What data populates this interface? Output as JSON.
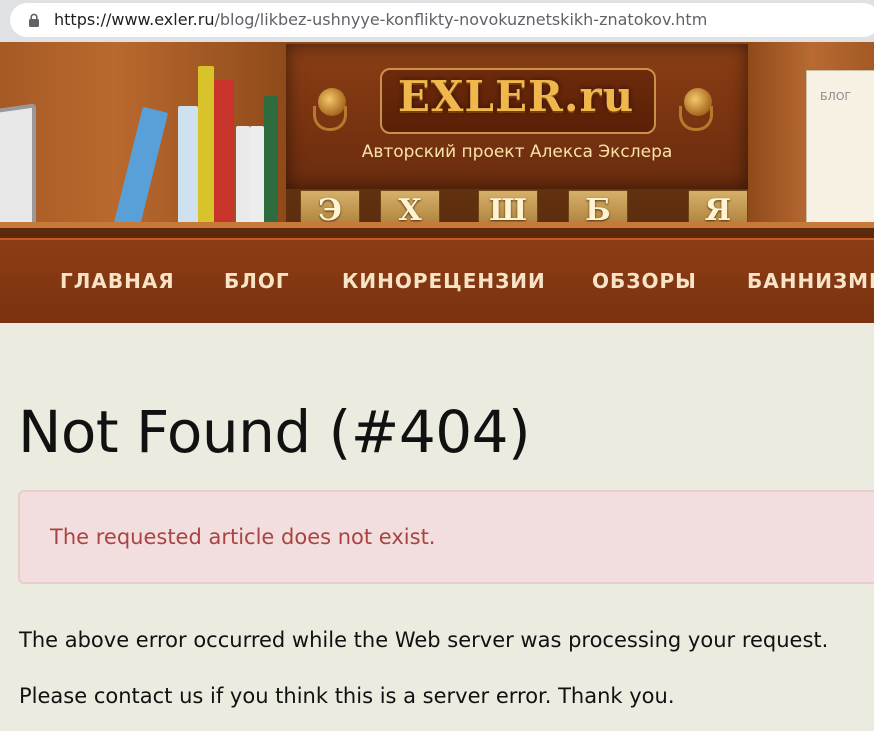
{
  "browser": {
    "url_host": "https://www.exler.ru",
    "url_path": "/blog/likbez-ushnyye-konflikty-novokuznetskikh-znatokov.htm"
  },
  "header": {
    "logo": "EXLER.ru",
    "tagline": "Авторский проект Алекса Экслера",
    "note_label": "БЛОГ",
    "letter_blocks": [
      "Э",
      "Х",
      "Ш",
      "Б",
      "Я"
    ]
  },
  "nav": {
    "items": [
      "ГЛАВНАЯ",
      "БЛОГ",
      "КИНОРЕЦЕНЗИИ",
      "ОБЗОРЫ",
      "БАННИЗМЫ"
    ]
  },
  "main": {
    "title": "Not Found (#404)",
    "alert": "The requested article does not exist.",
    "paragraph_1": "The above error occurred while the Web server was processing your request.",
    "paragraph_2": "Please contact us if you think this is a server error. Thank you."
  },
  "colors": {
    "nav_bg": "#8d3d14",
    "nav_text": "#f7e4c6",
    "page_bg": "#ecebe0",
    "alert_bg": "#f2dede",
    "alert_text": "#a94442",
    "logo": "#f0b84c"
  }
}
